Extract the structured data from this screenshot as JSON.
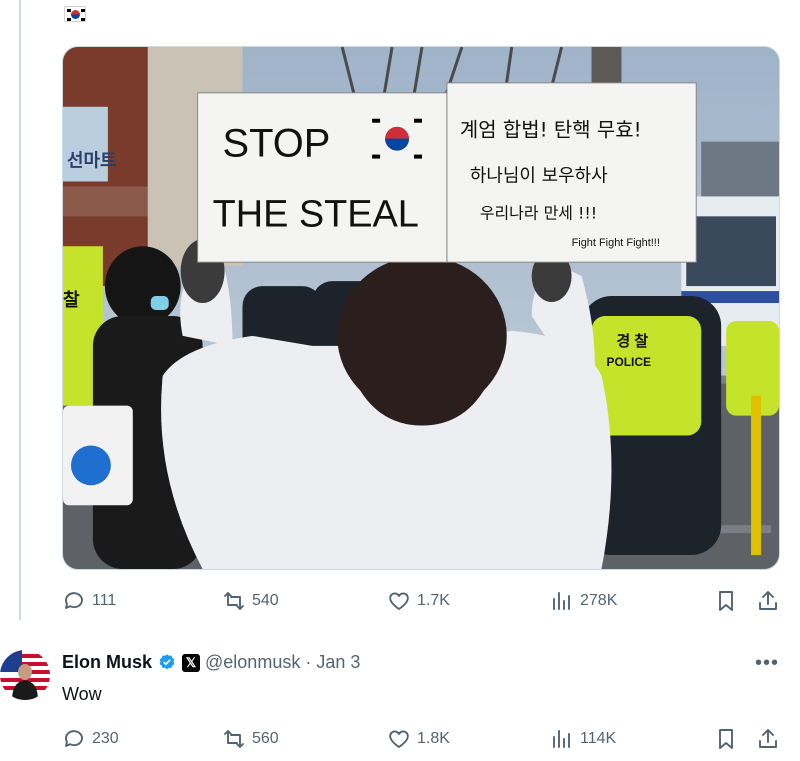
{
  "post": {
    "text_emoji_label": "🇰🇷",
    "image": {
      "sign_left_line1": "STOP",
      "sign_left_line2": "THE STEAL",
      "sign_right_line1": "계엄 합법! 탄핵 무효!",
      "sign_right_line2": "하나님이 보우하사",
      "sign_right_line3": "우리나라 만세 !!!",
      "sign_right_line4": "Fight Fight Fight!!!",
      "police_text": "경 찰",
      "police_text2": "POLICE",
      "store_sign": "선마트",
      "store_sign2": "찰"
    },
    "stats": {
      "replies": "111",
      "reposts": "540",
      "likes": "1.7K",
      "views": "278K"
    }
  },
  "reply": {
    "name": "Elon Musk",
    "x_badge": "𝕏",
    "handle": "@elonmusk",
    "separator": "·",
    "date": "Jan 3",
    "more": "•••",
    "text": "Wow",
    "stats": {
      "replies": "230",
      "reposts": "560",
      "likes": "1.8K",
      "views": "114K"
    }
  },
  "colors": {
    "verified": "#1d9bf0",
    "secondary_text": "#536471",
    "police_vest": "#c6e32c"
  },
  "icons": [
    "flag-kr-icon",
    "reply-icon",
    "repost-icon",
    "like-icon",
    "views-icon",
    "bookmark-icon",
    "share-icon",
    "verified-icon",
    "x-logo-icon",
    "more-icon"
  ]
}
